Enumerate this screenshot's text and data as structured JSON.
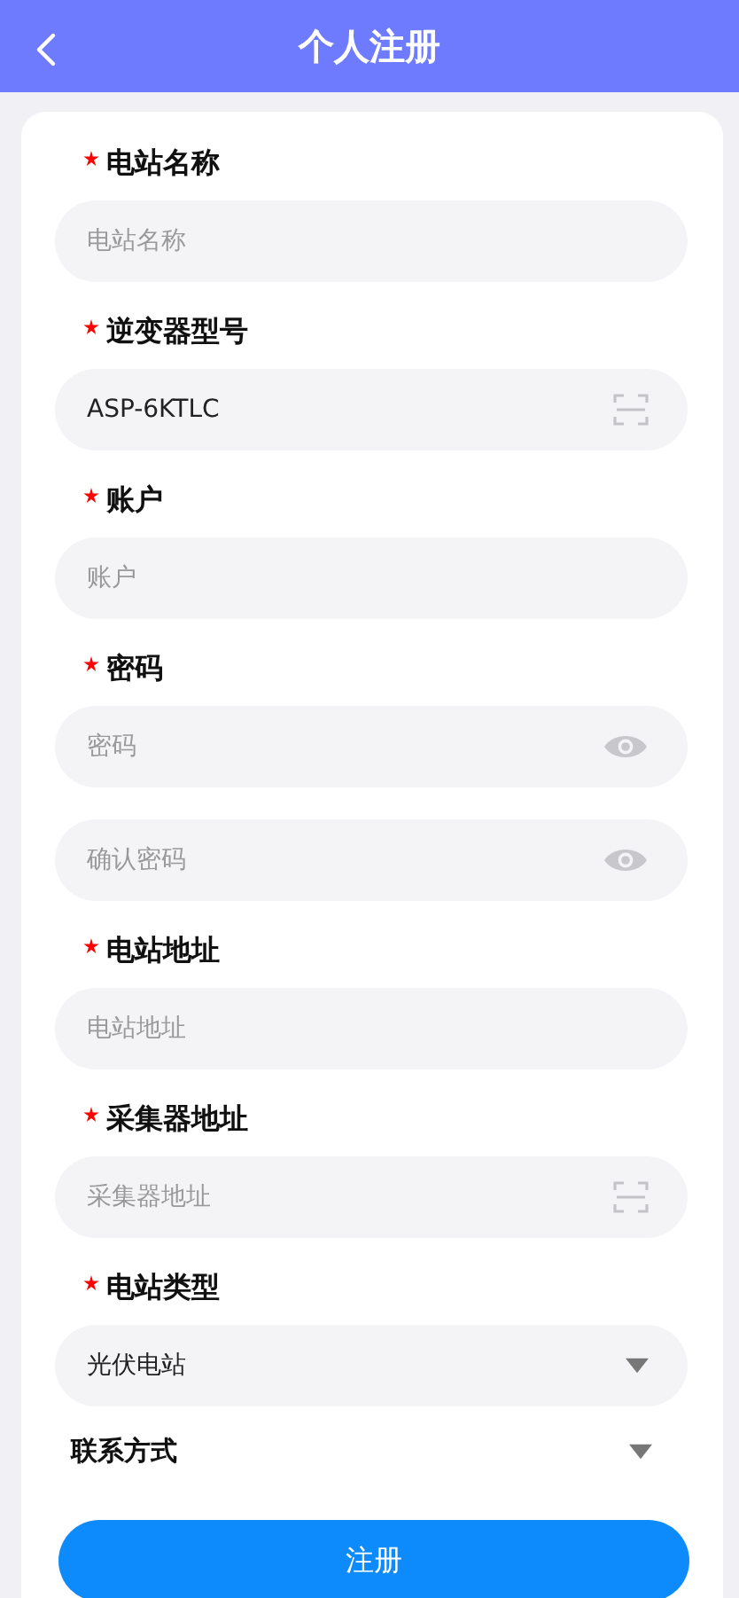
{
  "header": {
    "title": "个人注册"
  },
  "fields": [
    {
      "label": "电站名称",
      "required": true,
      "inputs": [
        {
          "kind": "text",
          "placeholder": "电站名称"
        }
      ]
    },
    {
      "label": "逆变器型号",
      "required": true,
      "inputs": [
        {
          "kind": "scan",
          "value": "ASP-6KTLC"
        }
      ]
    },
    {
      "label": "账户",
      "required": true,
      "inputs": [
        {
          "kind": "text",
          "placeholder": "账户"
        }
      ]
    },
    {
      "label": "密码",
      "required": true,
      "inputs": [
        {
          "kind": "password",
          "placeholder": "密码"
        },
        {
          "kind": "password",
          "placeholder": "确认密码"
        }
      ]
    },
    {
      "label": "电站地址",
      "required": true,
      "inputs": [
        {
          "kind": "text",
          "placeholder": "电站地址"
        }
      ]
    },
    {
      "label": "采集器地址",
      "required": true,
      "inputs": [
        {
          "kind": "scan",
          "placeholder": "采集器地址"
        }
      ]
    },
    {
      "label": "电站类型",
      "required": true,
      "inputs": [
        {
          "kind": "select",
          "value": "光伏电站"
        }
      ]
    }
  ],
  "contact": {
    "label": "联系方式",
    "expanded": false
  },
  "submit": "注册"
}
